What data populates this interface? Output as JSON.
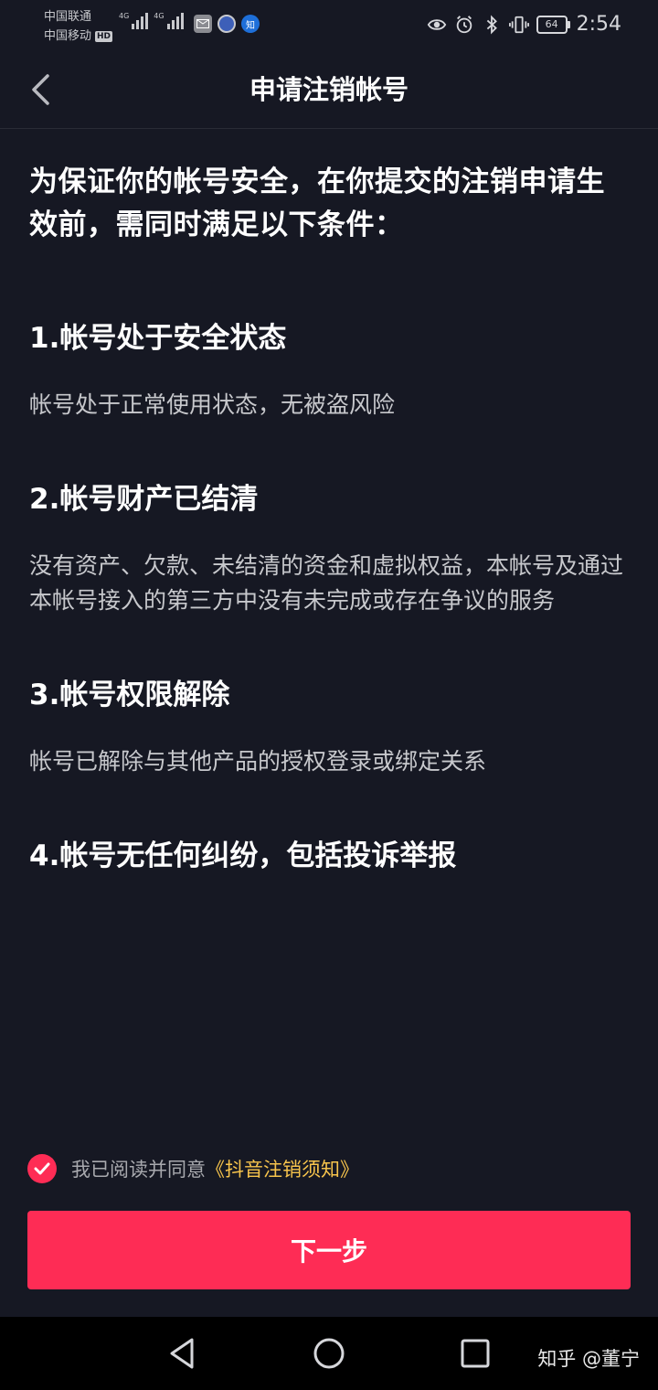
{
  "status_bar": {
    "carrier_1": "中国联通",
    "carrier_2": "中国移动",
    "hd_badge": "HD",
    "signal_1_tag": "4G",
    "signal_2_tag": "4G",
    "app_icon_3_glyph": "知",
    "battery_level": "64",
    "time": "2:54"
  },
  "nav": {
    "title": "申请注销帐号"
  },
  "content": {
    "intro": "为保证你的帐号安全，在你提交的注销申请生效前，需同时满足以下条件：",
    "conditions": [
      {
        "title": "1.帐号处于安全状态",
        "description": "帐号处于正常使用状态，无被盗风险"
      },
      {
        "title": "2.帐号财产已结清",
        "description": "没有资产、欠款、未结清的资金和虚拟权益，本帐号及通过本帐号接入的第三方中没有未完成或存在争议的服务"
      },
      {
        "title": "3.帐号权限解除",
        "description": "帐号已解除与其他产品的授权登录或绑定关系"
      },
      {
        "title": "4.帐号无任何纠纷，包括投诉举报",
        "description": ""
      }
    ]
  },
  "agreement": {
    "checked": true,
    "text": "我已阅读并同意",
    "link_text": "《抖音注销须知》"
  },
  "next_button": {
    "label": "下一步"
  },
  "watermark": "知乎 @董宁",
  "colors": {
    "background": "#161823",
    "accent": "#fe2c55",
    "link": "#f7c44c",
    "system_nav": "#000000"
  }
}
